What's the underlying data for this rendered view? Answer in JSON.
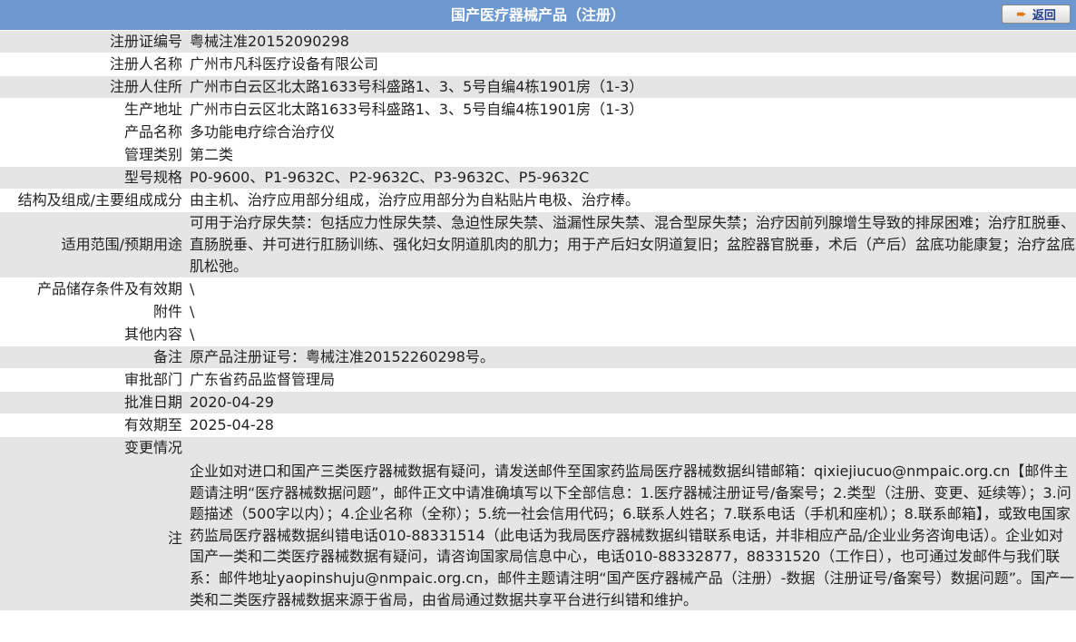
{
  "header": {
    "title": "国产医疗器械产品（注册）",
    "back_label": "返回"
  },
  "fields": [
    {
      "label": "注册证编号",
      "value": "粤械注准20152090298"
    },
    {
      "label": "注册人名称",
      "value": "广州市凡科医疗设备有限公司"
    },
    {
      "label": "注册人住所",
      "value": "广州市白云区北太路1633号科盛路1、3、5号自编4栋1901房（1-3）"
    },
    {
      "label": "生产地址",
      "value": "广州市白云区北太路1633号科盛路1、3、5号自编4栋1901房（1-3）"
    },
    {
      "label": "产品名称",
      "value": "多功能电疗综合治疗仪"
    },
    {
      "label": "管理类别",
      "value": "第二类"
    },
    {
      "label": "型号规格",
      "value": "P0-9600、P1-9632C、P2-9632C、P3-9632C、P5-9632C"
    },
    {
      "label": "结构及组成/主要组成成分",
      "value": "由主机、治疗应用部分组成，治疗应用部分为自粘贴片电极、治疗棒。"
    },
    {
      "label": "适用范围/预期用途",
      "value": "可用于治疗尿失禁：包括应力性尿失禁、急迫性尿失禁、溢漏性尿失禁、混合型尿失禁；治疗因前列腺增生导致的排尿困难；治疗肛脱垂、直肠脱垂、并可进行肛肠训练、强化妇女阴道肌肉的肌力；用于产后妇女阴道复旧；盆腔器官脱垂，术后（产后）盆底功能康复；治疗盆底肌松弛。"
    },
    {
      "label": "产品储存条件及有效期",
      "value": "\\"
    },
    {
      "label": "附件",
      "value": "\\"
    },
    {
      "label": "其他内容",
      "value": "\\"
    },
    {
      "label": "备注",
      "value": "原产品注册证号：粤械注准20152260298号。"
    },
    {
      "label": "审批部门",
      "value": "广东省药品监督管理局"
    },
    {
      "label": "批准日期",
      "value": "2020-04-29"
    },
    {
      "label": "有效期至",
      "value": "2025-04-28"
    },
    {
      "label": "变更情况",
      "value": ""
    }
  ],
  "note": {
    "label": "注",
    "text": "企业如对进口和国产三类医疗器械数据有疑问，请发送邮件至国家药监局医疗器械数据纠错邮箱：qixiejiucuo@nmpaic.org.cn【邮件主题请注明“医疗器械数据问题”，邮件正文中请准确填写以下全部信息：1.医疗器械注册证号/备案号；2.类型（注册、变更、延续等）；3.问题描述（500字以内）；4.企业名称（全称）；5.统一社会信用代码；6.联系人姓名；7.联系电话（手机和座机）；8.联系邮箱】，或致电国家药监局医疗器械数据纠错电话010-88331514（此电话为我局医疗器械数据纠错联系电话，并非相应产品/企业业务咨询电话）。企业如对国产一类和二类医疗器械数据有疑问，请咨询国家局信息中心，电话010-88332877，88331520（工作日），也可通过发邮件与我们联系：邮件地址yaopinshuju@nmpaic.org.cn，邮件主题请注明“国产医疗器械产品（注册）-数据（注册证号/备案号）数据问题”。国产一类和二类医疗器械数据来源于省局，由省局通过数据共享平台进行纠错和维护。"
  },
  "colors": {
    "header_bg": "#6c97cf",
    "row_gray": "#e5e5e5",
    "row_white": "#ffffff"
  }
}
